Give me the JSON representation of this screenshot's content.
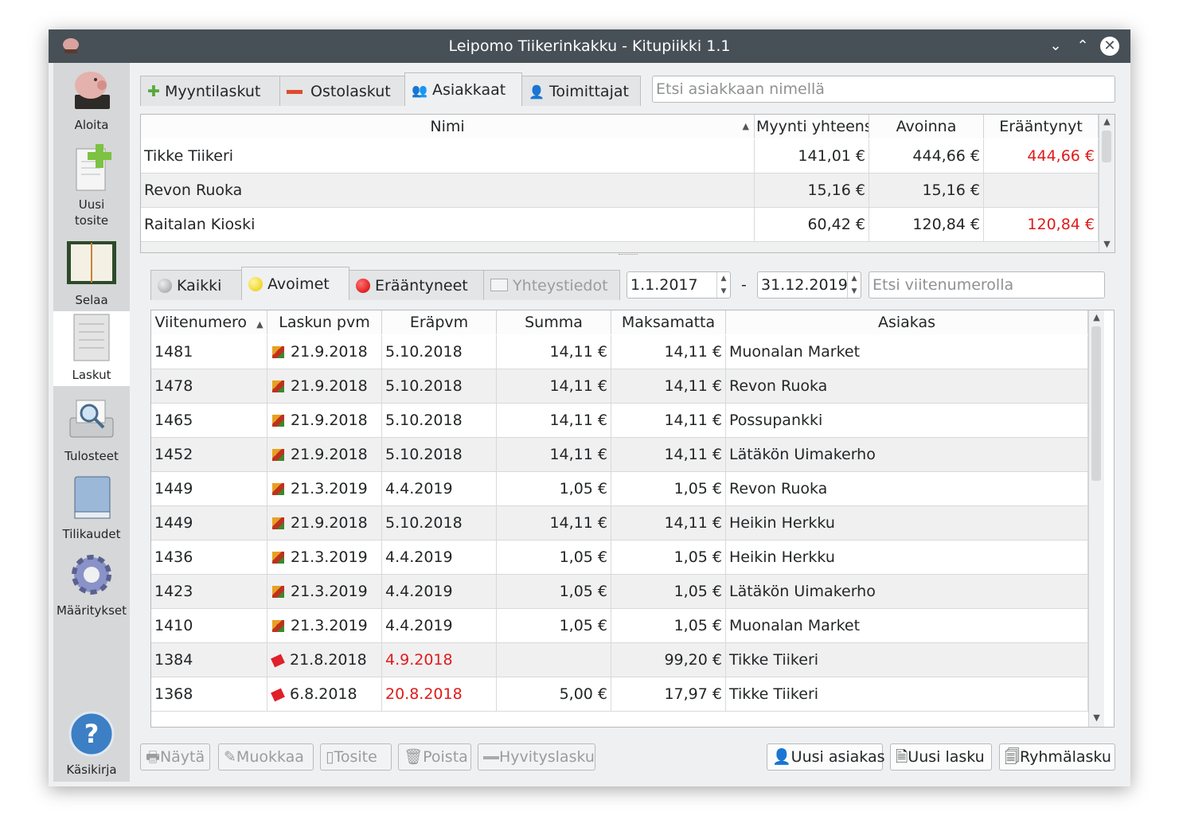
{
  "window": {
    "title": "Leipomo Tiikerinkakku - Kitupiikki 1.1"
  },
  "sidebar": {
    "items": [
      {
        "label": "Aloita",
        "icon": "piggy-bank-icon"
      },
      {
        "label": "Uusi tosite",
        "icon": "new-voucher-icon"
      },
      {
        "label": "Selaa",
        "icon": "ledger-book-icon"
      },
      {
        "label": "Laskut",
        "icon": "invoice-icon"
      },
      {
        "label": "Tulosteet",
        "icon": "printer-preview-icon"
      },
      {
        "label": "Tilikaudet",
        "icon": "book-icon"
      },
      {
        "label": "Määritykset",
        "icon": "gear-icon"
      },
      {
        "label": "Käsikirja",
        "icon": "help-icon"
      }
    ],
    "active": "Laskut"
  },
  "top_tabs": [
    {
      "label": "Myyntilaskut",
      "accel": "M"
    },
    {
      "label": "Ostolaskut",
      "accel": "O"
    },
    {
      "label": "Asiakkaat",
      "accel": "A"
    },
    {
      "label": "Toimittajat",
      "accel": "T"
    }
  ],
  "active_top_tab": "Asiakkaat",
  "customer_search": {
    "placeholder": "Etsi asiakkaan nimellä"
  },
  "customers": {
    "headers": [
      "Nimi",
      "Myynti yhteensä",
      "Avoinna",
      "Erääntynyt"
    ],
    "rows": [
      {
        "name": "Tikke Tiikeri",
        "sales": "141,01 €",
        "open": "444,66 €",
        "overdue": "444,66 €"
      },
      {
        "name": "Revon Ruoka",
        "sales": "15,16 €",
        "open": "15,16 €",
        "overdue": ""
      },
      {
        "name": "Raitalan Kioski",
        "sales": "60,42 €",
        "open": "120,84 €",
        "overdue": "120,84 €"
      }
    ]
  },
  "filter_tabs": [
    {
      "label": "Kaikki",
      "accel": "K"
    },
    {
      "label": "Avoimet",
      "accel": "A"
    },
    {
      "label": "Erääntyneet",
      "accel": "E"
    },
    {
      "label": "Yhteystiedot",
      "accel": "Y"
    }
  ],
  "active_filter_tab": "Avoimet",
  "date_from": "1.1.2017",
  "date_separator": "-",
  "date_to": "31.12.2019",
  "ref_search": {
    "placeholder": "Etsi viitenumerolla"
  },
  "invoices": {
    "headers": [
      "Viitenumero",
      "Laskun pvm",
      "Eräpvm",
      "Summa",
      "Maksamatta",
      "Asiakas"
    ],
    "rows": [
      {
        "ref": "1481",
        "date": "21.9.2018",
        "due": "5.10.2018",
        "sum": "14,11 €",
        "unpaid": "14,11 €",
        "customer": "Muonalan Market",
        "overdue": false
      },
      {
        "ref": "1478",
        "date": "21.9.2018",
        "due": "5.10.2018",
        "sum": "14,11 €",
        "unpaid": "14,11 €",
        "customer": "Revon Ruoka",
        "overdue": false
      },
      {
        "ref": "1465",
        "date": "21.9.2018",
        "due": "5.10.2018",
        "sum": "14,11 €",
        "unpaid": "14,11 €",
        "customer": "Possupankki",
        "overdue": false
      },
      {
        "ref": "1452",
        "date": "21.9.2018",
        "due": "5.10.2018",
        "sum": "14,11 €",
        "unpaid": "14,11 €",
        "customer": "Lätäkön Uimakerho",
        "overdue": false
      },
      {
        "ref": "1449",
        "date": "21.3.2019",
        "due": "4.4.2019",
        "sum": "1,05 €",
        "unpaid": "1,05 €",
        "customer": "Revon Ruoka",
        "overdue": false
      },
      {
        "ref": "1449",
        "date": "21.9.2018",
        "due": "5.10.2018",
        "sum": "14,11 €",
        "unpaid": "14,11 €",
        "customer": "Heikin Herkku",
        "overdue": false
      },
      {
        "ref": "1436",
        "date": "21.3.2019",
        "due": "4.4.2019",
        "sum": "1,05 €",
        "unpaid": "1,05 €",
        "customer": "Heikin Herkku",
        "overdue": false
      },
      {
        "ref": "1423",
        "date": "21.3.2019",
        "due": "4.4.2019",
        "sum": "1,05 €",
        "unpaid": "1,05 €",
        "customer": "Lätäkön Uimakerho",
        "overdue": false
      },
      {
        "ref": "1410",
        "date": "21.3.2019",
        "due": "4.4.2019",
        "sum": "1,05 €",
        "unpaid": "1,05 €",
        "customer": "Muonalan Market",
        "overdue": false
      },
      {
        "ref": "1384",
        "date": "21.8.2018",
        "due": "4.9.2018",
        "sum": "",
        "unpaid": "99,20 €",
        "customer": "Tikke Tiikeri",
        "overdue": true
      },
      {
        "ref": "1368",
        "date": "6.8.2018",
        "due": "20.8.2018",
        "sum": "5,00 €",
        "unpaid": "17,97 €",
        "customer": "Tikke Tiikeri",
        "overdue": true
      }
    ]
  },
  "buttons_left": [
    {
      "label": "Näytä",
      "icon": "print-icon"
    },
    {
      "label": "Muokkaa",
      "icon": "pencil-icon"
    },
    {
      "label": "Tosite",
      "icon": "document-icon"
    },
    {
      "label": "Poista",
      "icon": "trash-icon"
    },
    {
      "label": "Hyvityslasku",
      "icon": "minus-icon"
    }
  ],
  "buttons_right": [
    {
      "label": "Uusi asiakas",
      "icon": "person-icon"
    },
    {
      "label": "Uusi lasku",
      "icon": "new-document-icon"
    },
    {
      "label": "Ryhmälasku",
      "icon": "documents-icon"
    }
  ],
  "colors": {
    "overdue": "#e01b1b",
    "titlebar": "#475057",
    "sidebar": "#d6d7d8"
  }
}
